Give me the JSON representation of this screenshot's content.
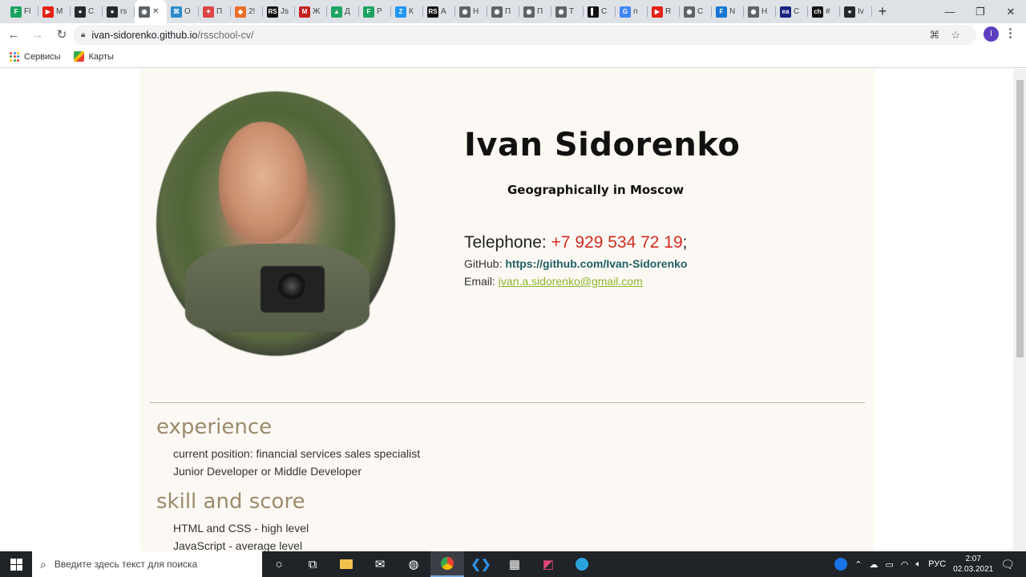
{
  "browser": {
    "tabs": [
      {
        "label": "Fl",
        "favicon": "F",
        "color": "#1da462"
      },
      {
        "label": "M",
        "favicon": "▶",
        "color": "#e62117"
      },
      {
        "label": "C",
        "favicon": "●",
        "color": "#24292e"
      },
      {
        "label": "rs",
        "favicon": "●",
        "color": "#24292e"
      },
      {
        "label": "✕",
        "favicon": "◉",
        "color": "#5f6368",
        "active": true
      },
      {
        "label": "O",
        "favicon": "⌘",
        "color": "#2d8cc8"
      },
      {
        "label": "П",
        "favicon": "✦",
        "color": "#d44"
      },
      {
        "label": "2!",
        "favicon": "◆",
        "color": "#e8702a"
      },
      {
        "label": "Js",
        "favicon": "RS",
        "color": "#111"
      },
      {
        "label": "Ж",
        "favicon": "M",
        "color": "#c5221f"
      },
      {
        "label": "Д",
        "favicon": "▲",
        "color": "#1fa463"
      },
      {
        "label": "Р",
        "favicon": "F",
        "color": "#1da462"
      },
      {
        "label": "К",
        "favicon": "Z",
        "color": "#2196f3"
      },
      {
        "label": "A",
        "favicon": "RS",
        "color": "#111"
      },
      {
        "label": "Н",
        "favicon": "◉",
        "color": "#5f6368"
      },
      {
        "label": "П",
        "favicon": "◉",
        "color": "#5f6368"
      },
      {
        "label": "П",
        "favicon": "◉",
        "color": "#5f6368"
      },
      {
        "label": "Т",
        "favicon": "◉",
        "color": "#5f6368"
      },
      {
        "label": "С",
        "favicon": "▌",
        "color": "#111"
      },
      {
        "label": "n",
        "favicon": "G",
        "color": "#4285f4"
      },
      {
        "label": "R",
        "favicon": "▶",
        "color": "#e62117"
      },
      {
        "label": "С",
        "favicon": "◉",
        "color": "#5f6368"
      },
      {
        "label": "N",
        "favicon": "F",
        "color": "#1976d2"
      },
      {
        "label": "Н",
        "favicon": "◉",
        "color": "#5f6368"
      },
      {
        "label": "С",
        "favicon": "ea",
        "color": "#1a237e"
      },
      {
        "label": "#",
        "favicon": "ch",
        "color": "#111"
      },
      {
        "label": "Iv",
        "favicon": "●",
        "color": "#24292e"
      }
    ],
    "new_tab": "+",
    "window_controls": [
      "—",
      "❐",
      "✕"
    ],
    "url_host": "ivan-sidorenko.github.io",
    "url_path": "/rsschool-cv/",
    "profile_initial": "I",
    "bookmarks": [
      {
        "label": "Сервисы",
        "icon": "apps-grid-icon"
      },
      {
        "label": "Карты",
        "icon": "maps-icon"
      }
    ]
  },
  "cv": {
    "name": "Ivan Sidorenko",
    "location": "Geographically in Moscow",
    "telephone_label": "Telephone: ",
    "telephone": "+7 929 534 72 19",
    "telephone_suffix": ";",
    "github_label": "GitHub: ",
    "github": "https://github.com/Ivan-Sidorenko",
    "email_label": "Email: ",
    "email": "ivan.a.sidorenko@gmail.com",
    "sections": [
      {
        "title": "experience",
        "items": [
          "current position: financial services sales specialist",
          "Junior Developer or Middle Developer"
        ]
      },
      {
        "title": "skill and score",
        "items": [
          "HTML and CSS - high level",
          "JavaScript - average level"
        ]
      }
    ]
  },
  "taskbar": {
    "search_placeholder": "Введите здесь текст для поиска",
    "language": "РУС",
    "time": "2:07",
    "date": "02.03.2021"
  }
}
